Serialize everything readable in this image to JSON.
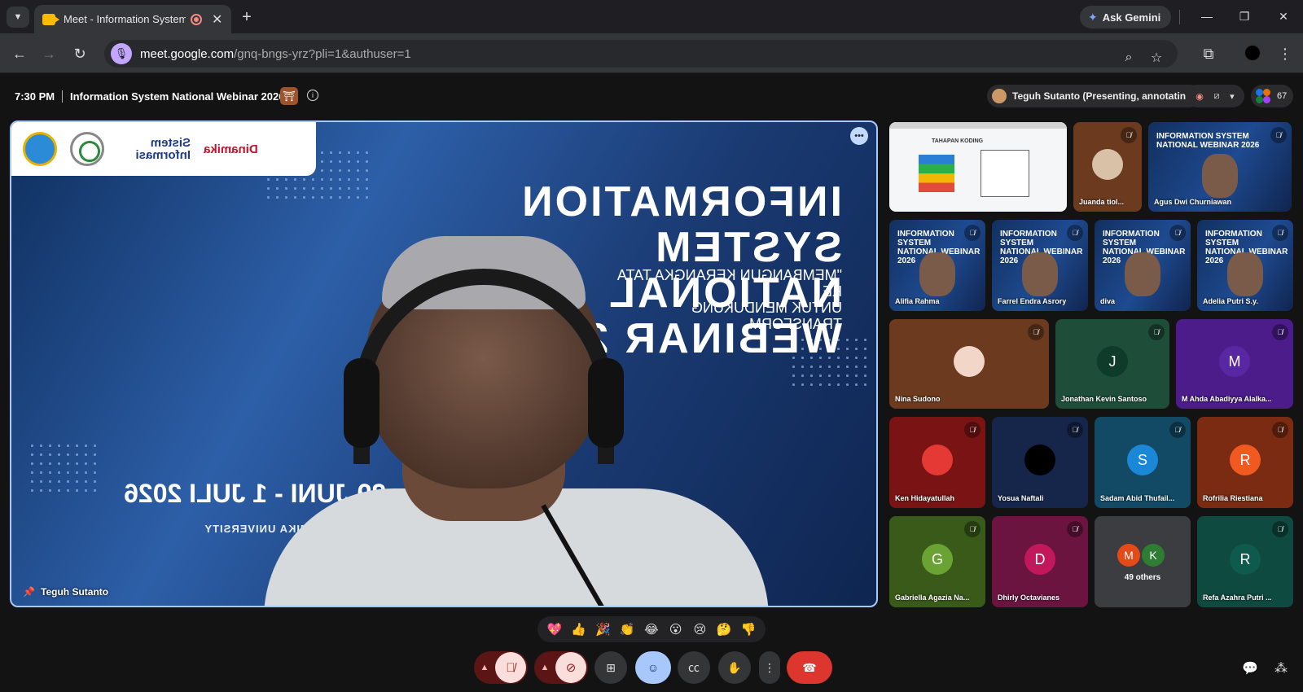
{
  "browser": {
    "tab_title": "Meet - Information System",
    "new_tab": "+",
    "ask_gemini": "Ask Gemini",
    "url_host": "meet.google.com",
    "url_path": "/gnq-bngs-yrz?pli=1&authuser=1"
  },
  "meet": {
    "time": "7:30 PM",
    "meeting_name": "Information System National Webinar 2026",
    "presenter_label": "Teguh Sutanto (Presenting, annotating)",
    "participant_count": "67"
  },
  "main_tile": {
    "speaker": "Teguh Sutanto",
    "slide_title_line1": "INFORMATION SYSTEM",
    "slide_title_line2": "NATIONAL WEBINAR 2026",
    "slide_subtitle_line1": "\"MEMBANGUN KERANGKA TATA KE",
    "slide_subtitle_line2": "UNTUK MENDUKUNG TRANSFORM",
    "slide_date": "29 JUNI - 1 JULI 2026",
    "slide_org": "ROGRAM, DINAMIKA UNIVERSITY",
    "logo_sistem": "Sistem Informasi",
    "logo_dinamika": "Dinamika"
  },
  "participants": [
    {
      "name": "Juanda tiol...",
      "type": "photo",
      "bg": "#6b3a1f",
      "avatar_color": "#d9c1a8"
    },
    {
      "name": "Agus Dwi Churniawan",
      "type": "slide"
    },
    {
      "name": "Alifia Rahma",
      "type": "slide"
    },
    {
      "name": "Farrel Endra Asrory",
      "type": "slide"
    },
    {
      "name": "diva",
      "type": "slide"
    },
    {
      "name": "Adelia Putri S.y.",
      "type": "slide"
    },
    {
      "name": "Nina Sudono",
      "type": "photo",
      "bg": "#6b3a1f",
      "avatar_color": "#f2d7c8"
    },
    {
      "name": "Jonathan Kevin Santoso",
      "type": "initial",
      "initial": "J",
      "bg": "#1e4d3a",
      "avatar_color": "#0e3b2a"
    },
    {
      "name": "M Ahda Abadiyya Alalka...",
      "type": "initial",
      "initial": "M",
      "bg": "#4b1c8a",
      "avatar_color": "#5a27a3"
    },
    {
      "name": "Ken Hidayatullah",
      "type": "photo",
      "bg": "#7a1414",
      "avatar_color": "#e53935"
    },
    {
      "name": "Yosua Naftali",
      "type": "photo",
      "bg": "#15264a",
      "avatar_color": "#000000"
    },
    {
      "name": "Sadam Abid Thufail...",
      "type": "initial",
      "initial": "S",
      "bg": "#124a66",
      "avatar_color": "#1a88d6"
    },
    {
      "name": "Rofrilia Riestiana",
      "type": "initial",
      "initial": "R",
      "bg": "#7a2b12",
      "avatar_color": "#f05a20"
    },
    {
      "name": "Gabriella Agazia Na...",
      "type": "initial",
      "initial": "G",
      "bg": "#3a5a1a",
      "avatar_color": "#6aa334"
    },
    {
      "name": "Dhirly Octavianes",
      "type": "initial",
      "initial": "D",
      "bg": "#6b1440",
      "avatar_color": "#c2185b"
    },
    {
      "name": "Refa Azahra Putri ...",
      "type": "initial",
      "initial": "R",
      "bg": "#0f4a40",
      "avatar_color": "#0e5a4d"
    }
  ],
  "others": {
    "label": "49 others",
    "a1": "M",
    "a2": "K",
    "c1": "#e64a19",
    "c2": "#2e7d32"
  },
  "reactions": [
    "💖",
    "👍",
    "🎉",
    "👏",
    "😂",
    "😮",
    "😢",
    "🤔",
    "👎"
  ],
  "icons": {
    "mic_off": "mic-off-icon",
    "cam_off": "camera-off-icon",
    "present": "present-screen-icon",
    "emoji": "emoji-icon",
    "captions": "captions-icon",
    "raise_hand": "raise-hand-icon",
    "more": "more-options-icon",
    "leave": "leave-call-icon",
    "chat": "chat-icon",
    "activities": "activities-icon"
  },
  "colors": {
    "accent_blue": "#a8c7fa",
    "leave_red": "#dc362e",
    "mic_cam_off_bg": "#f9dedc"
  }
}
